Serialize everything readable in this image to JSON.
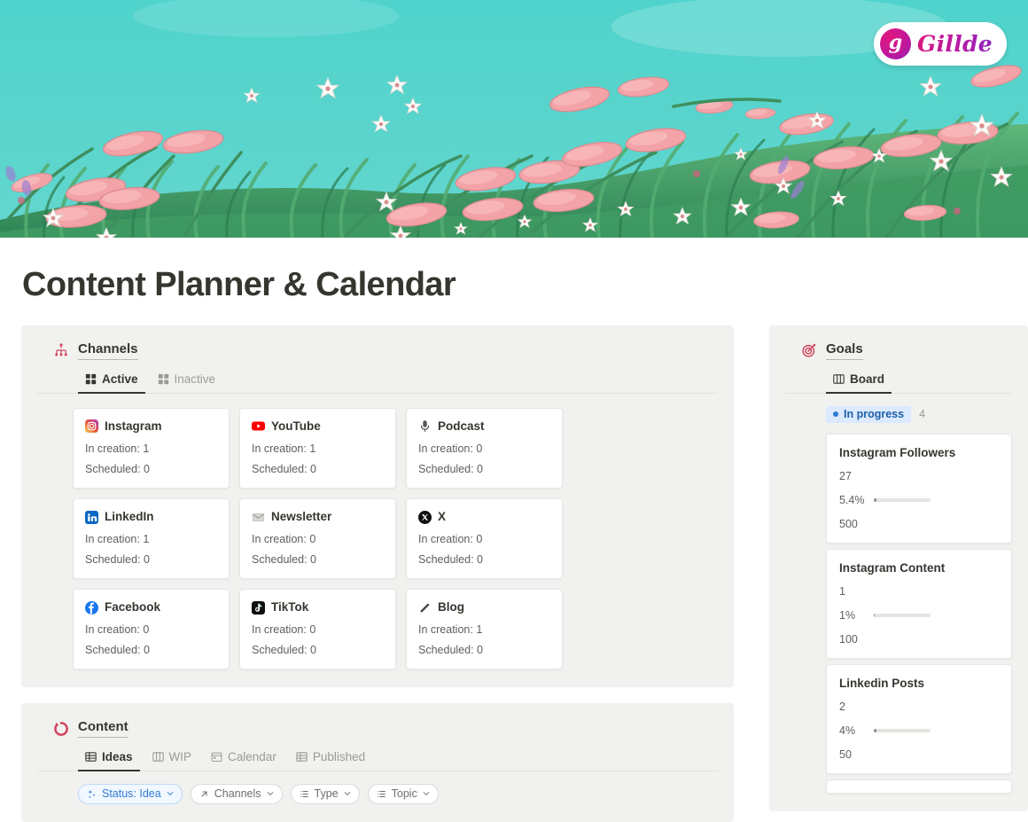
{
  "header": {
    "logo_mark": "g",
    "logo_text": "Gillde",
    "hero_alt": "illustrated-meadow-banner",
    "sky_color": "#4ecdc7",
    "flower_color": "#f2a0a4",
    "grass_color": "#4aa06c"
  },
  "page_title": "Content Planner & Calendar",
  "channels": {
    "title": "Channels",
    "icon": "hierarchy-icon",
    "icon_color": "#d1455e",
    "tabs": [
      {
        "label": "Active",
        "icon": "gallery-icon",
        "active": true
      },
      {
        "label": "Inactive",
        "icon": "gallery-icon",
        "active": false
      }
    ],
    "labels": {
      "in_creation": "In creation:",
      "scheduled": "Scheduled:"
    },
    "cards": [
      {
        "name": "Instagram",
        "icon": "instagram-icon",
        "in_creation": "1",
        "scheduled": "0"
      },
      {
        "name": "YouTube",
        "icon": "youtube-icon",
        "in_creation": "1",
        "scheduled": "0"
      },
      {
        "name": "Podcast",
        "icon": "microphone-icon",
        "in_creation": "0",
        "scheduled": "0"
      },
      {
        "name": "LinkedIn",
        "icon": "linkedin-icon",
        "in_creation": "1",
        "scheduled": "0"
      },
      {
        "name": "Newsletter",
        "icon": "envelope-icon",
        "in_creation": "0",
        "scheduled": "0"
      },
      {
        "name": "X",
        "icon": "x-twitter-icon",
        "in_creation": "0",
        "scheduled": "0"
      },
      {
        "name": "Facebook",
        "icon": "facebook-icon",
        "in_creation": "0",
        "scheduled": "0"
      },
      {
        "name": "TikTok",
        "icon": "tiktok-icon",
        "in_creation": "0",
        "scheduled": "0"
      },
      {
        "name": "Blog",
        "icon": "pencil-icon",
        "in_creation": "1",
        "scheduled": "0"
      }
    ]
  },
  "goals": {
    "title": "Goals",
    "icon": "target-icon",
    "icon_color": "#d1455e",
    "tabs": [
      {
        "label": "Board",
        "icon": "board-icon",
        "active": true
      }
    ],
    "status": {
      "label": "In progress",
      "count": "4",
      "color": "#2f7ad4",
      "bg": "#dbeafe"
    },
    "cards": [
      {
        "title": "Instagram Followers",
        "current": "27",
        "percent": "5.4%",
        "percent_value": 5.4,
        "target": "500"
      },
      {
        "title": "Instagram Content",
        "current": "1",
        "percent": "1%",
        "percent_value": 1,
        "target": "100"
      },
      {
        "title": "Linkedin Posts",
        "current": "2",
        "percent": "4%",
        "percent_value": 4,
        "target": "50"
      }
    ]
  },
  "content": {
    "title": "Content",
    "icon": "refresh-icon",
    "icon_color": "#d1455e",
    "tabs": [
      {
        "label": "Ideas",
        "icon": "table-icon",
        "active": true
      },
      {
        "label": "WIP",
        "icon": "board-icon",
        "active": false
      },
      {
        "label": "Calendar",
        "icon": "calendar-icon",
        "active": false
      },
      {
        "label": "Published",
        "icon": "table-icon",
        "active": false
      }
    ],
    "filters": [
      {
        "label": "Status: Idea",
        "icon": "sparkle-icon",
        "active": true
      },
      {
        "label": "Channels",
        "icon": "arrow-up-right-icon",
        "active": false
      },
      {
        "label": "Type",
        "icon": "list-icon",
        "active": false
      },
      {
        "label": "Topic",
        "icon": "list-icon",
        "active": false
      }
    ]
  }
}
